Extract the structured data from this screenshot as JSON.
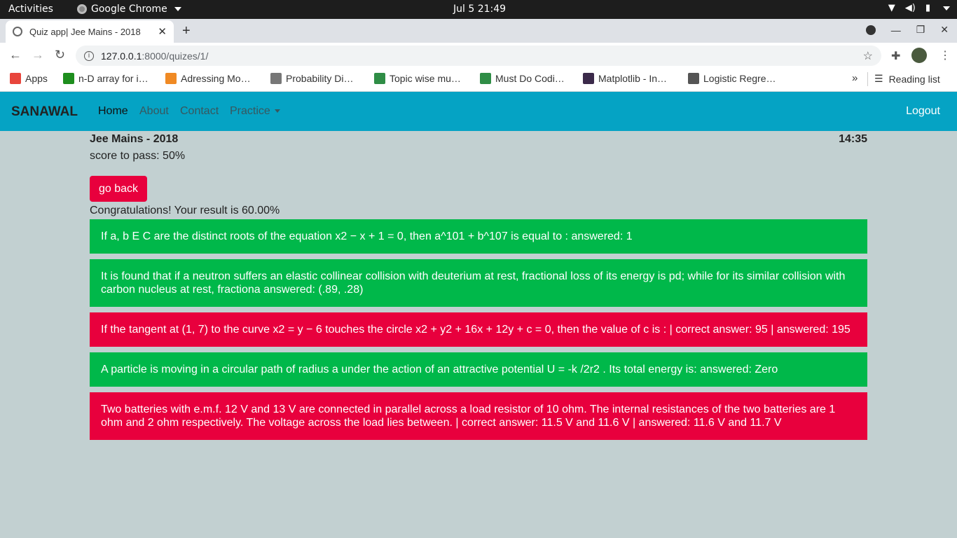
{
  "os": {
    "activities": "Activities",
    "app_name": "Google Chrome",
    "clock": "Jul 5  21:49"
  },
  "browser": {
    "tab_title": "Quiz app| Jee Mains - 2018",
    "url_host": "127.0.0.1",
    "url_path": ":8000/quizes/1/",
    "bookmarks": [
      {
        "label": "Apps",
        "icon": "apps-grid-icon",
        "color": "#e8453c"
      },
      {
        "label": "n-D array for i…",
        "icon": "bookmark-b-icon",
        "color": "#1e8e1e"
      },
      {
        "label": "Adressing Mo…",
        "icon": "bookmark-orange-icon",
        "color": "#f08a24"
      },
      {
        "label": "Probability Di…",
        "icon": "bookmark-gear-icon",
        "color": "#777777"
      },
      {
        "label": "Topic wise mu…",
        "icon": "geeksforgeeks-icon",
        "color": "#2f8d46"
      },
      {
        "label": "Must Do Codi…",
        "icon": "geeksforgeeks-icon",
        "color": "#2f8d46"
      },
      {
        "label": "Matplotlib - In…",
        "icon": "ml-icon",
        "color": "#3b2a4a"
      },
      {
        "label": "Logistic Regre…",
        "icon": "bookmark-doc-icon",
        "color": "#555555"
      }
    ],
    "reading_list": "Reading list"
  },
  "nav": {
    "brand": "SANAWAL",
    "links": [
      "Home",
      "About",
      "Contact",
      "Practice"
    ],
    "logout": "Logout"
  },
  "quiz": {
    "title": "Jee Mains - 2018",
    "timer": "14:35",
    "pass_score": "score to pass: 50%",
    "back_label": "go back",
    "result": "Congratulations! Your result is 60.00%",
    "questions": [
      {
        "text": "If a, b E C are the distinct roots of the equation x2 − x + 1 = 0, then a^101 + b^107 is equal to : answered: 1",
        "status": "correct"
      },
      {
        "text": "It is found that if a neutron suffers an elastic collinear collision with deuterium at rest, fractional loss of its energy is pd; while for its similar collision with carbon nucleus at rest, fractiona answered: (.89, .28)",
        "status": "correct"
      },
      {
        "text": "If the tangent at (1, 7) to the curve x2 = y − 6 touches the circle x2 + y2 + 16x + 12y + c = 0, then the value of c is : | correct answer: 95 | answered: 195",
        "status": "wrong"
      },
      {
        "text": "A particle is moving in a circular path of radius a under the action of an attractive potential U = -k /2r2 . Its total energy is: answered: Zero",
        "status": "correct"
      },
      {
        "text": "Two batteries with e.m.f. 12 V and 13 V are connected in parallel across a load resistor of 10 ohm. The internal resistances of the two batteries are 1 ohm and 2 ohm respectively. The voltage across the load lies between. | correct answer: 11.5 V and 11.6 V | answered: 11.6 V and 11.7 V",
        "status": "wrong"
      }
    ]
  },
  "colors": {
    "navbar": "#05a3c4",
    "page_bg": "#c2d0d1",
    "correct": "#00b84a",
    "wrong": "#e8003d"
  }
}
